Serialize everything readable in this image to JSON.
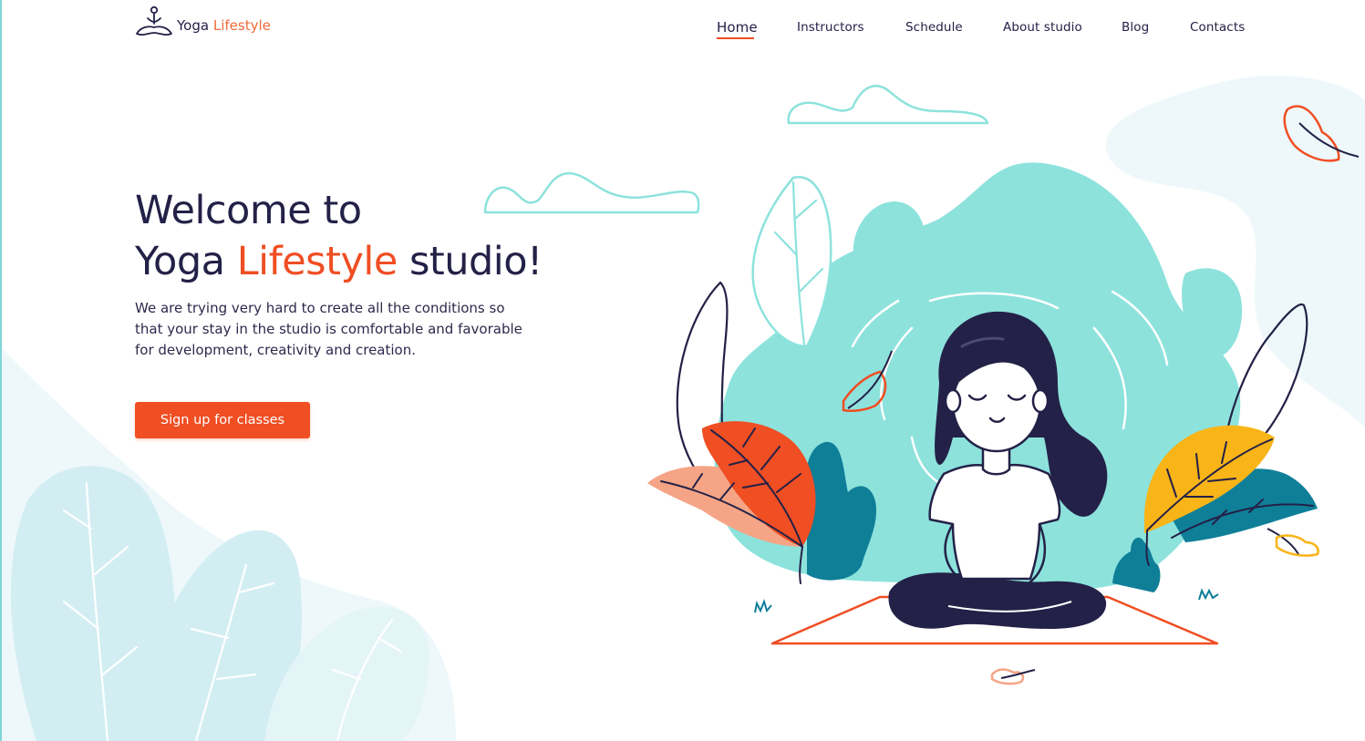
{
  "brand": {
    "name_part1": "Yoga",
    "name_part2": "Lifestyle",
    "logo_icon": "meditating-person-icon"
  },
  "nav": {
    "items": [
      {
        "label": "Home",
        "active": true
      },
      {
        "label": "Instructors",
        "active": false
      },
      {
        "label": "Schedule",
        "active": false
      },
      {
        "label": "About studio",
        "active": false
      },
      {
        "label": "Blog",
        "active": false
      },
      {
        "label": "Contacts",
        "active": false
      }
    ]
  },
  "hero": {
    "title_line1": "Welcome to",
    "title_line2_a": "Yoga ",
    "title_line2_accent": "Lifestyle",
    "title_line2_b": " studio!",
    "description": "We are trying very hard to create all the conditions so that your stay in the studio is comfortable and favorable for development, creativity and creation.",
    "cta_label": "Sign up for classes"
  },
  "colors": {
    "accent": "#f04e23",
    "dark": "#232147",
    "teal": "#8de2dc",
    "deep_teal": "#0f7f98",
    "light_blue": "#d2eef3",
    "yellow": "#f9b418",
    "peach": "#f5a586"
  }
}
